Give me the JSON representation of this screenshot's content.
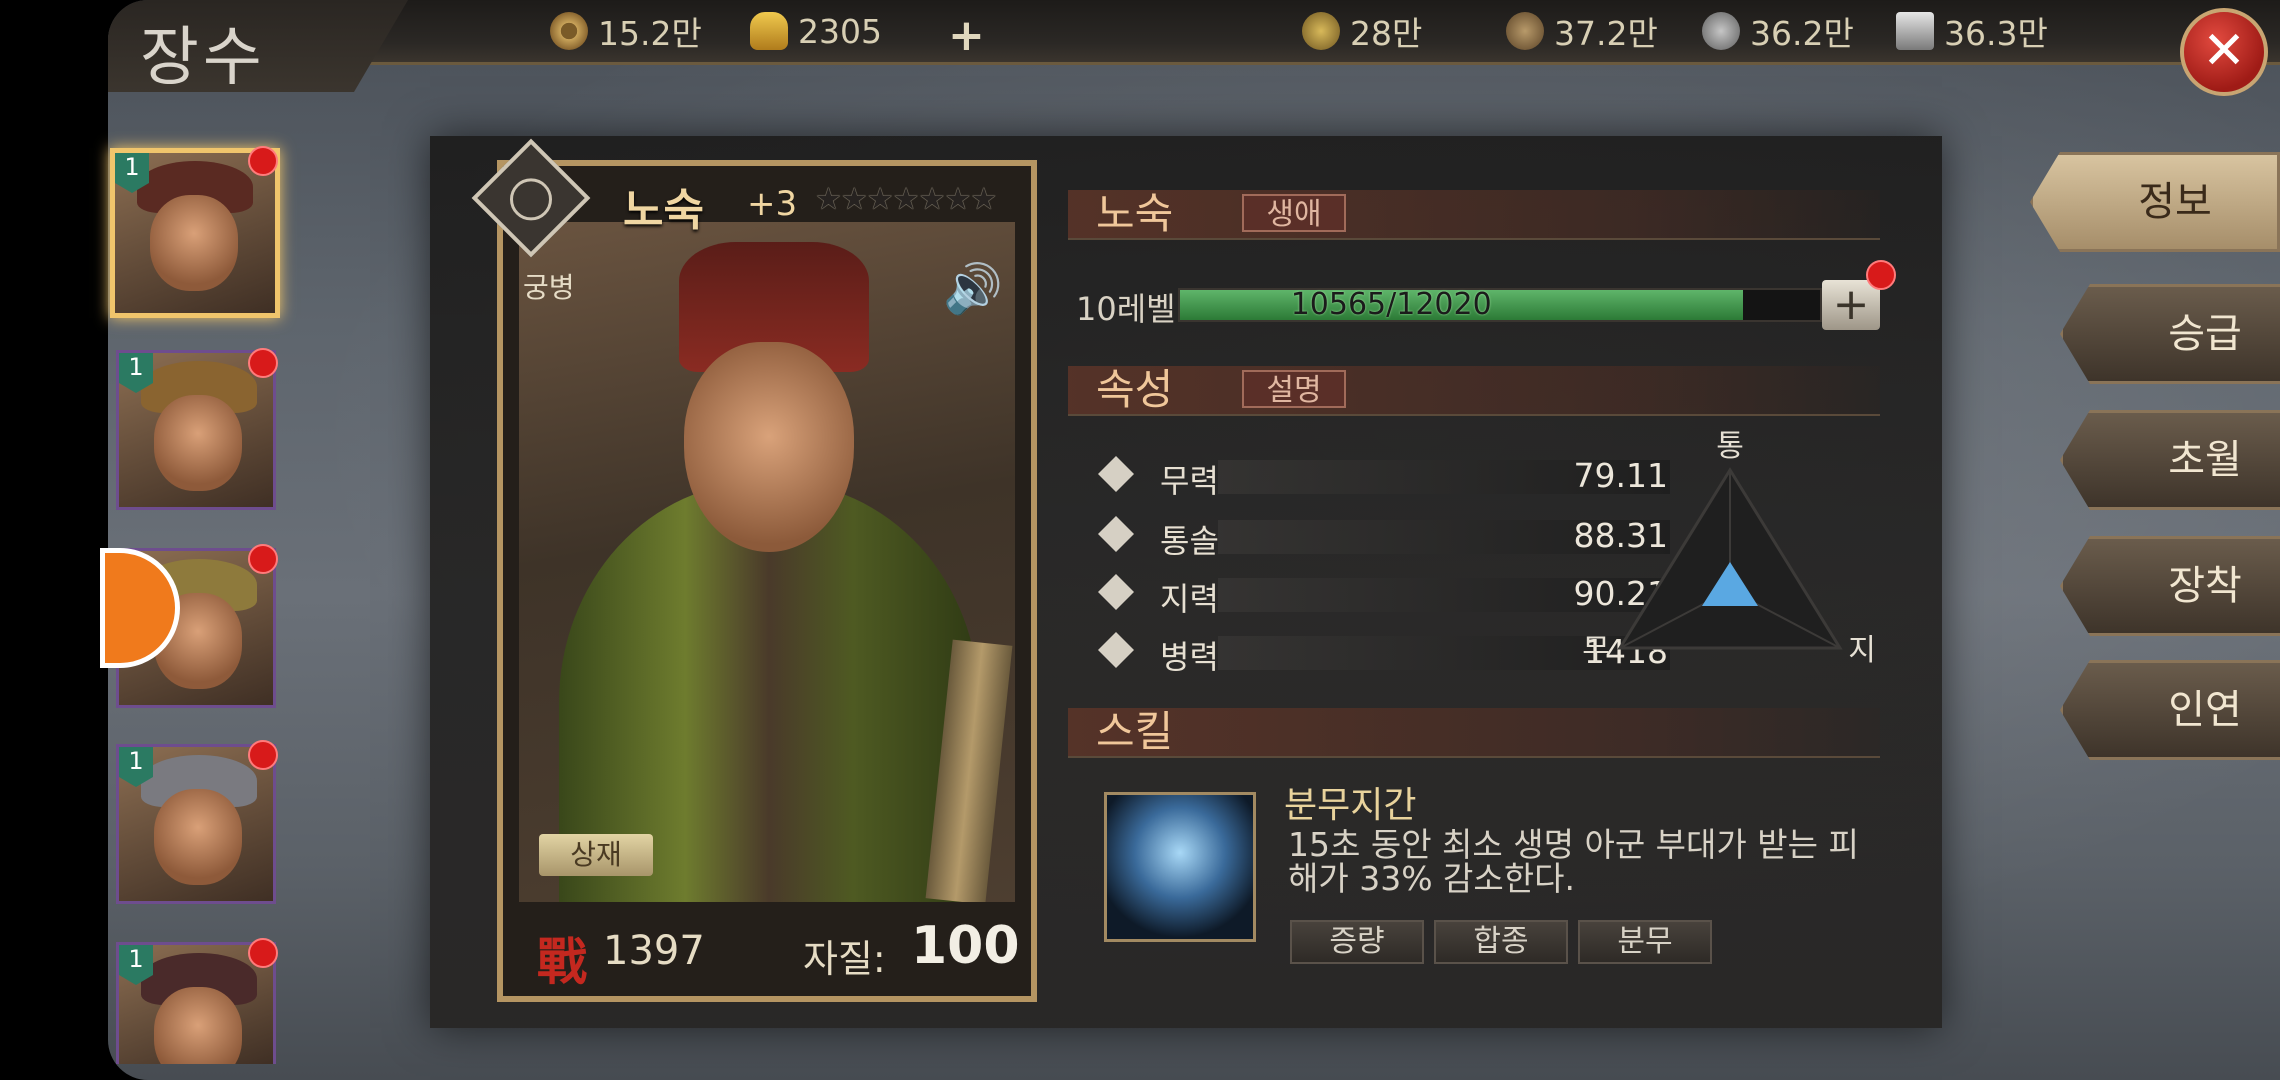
{
  "header": {
    "title": "장수",
    "currency": [
      {
        "icon": "copper-coin-icon",
        "value": "15.2만"
      },
      {
        "icon": "gold-ingot-icon",
        "value": "2305"
      }
    ],
    "add_label": "+",
    "resources": [
      {
        "icon": "grain-icon",
        "value": "28만"
      },
      {
        "icon": "wood-icon",
        "value": "37.2만"
      },
      {
        "icon": "stone-icon",
        "value": "36.2만"
      },
      {
        "icon": "iron-icon",
        "value": "36.3만"
      }
    ],
    "close_label": "✕"
  },
  "hero_list": [
    {
      "level": "1",
      "selected": true,
      "helm_color": "#5a2a22"
    },
    {
      "level": "1",
      "selected": false,
      "helm_color": "#8a6430"
    },
    {
      "level": "",
      "selected": false,
      "helm_color": "#8e7a3c"
    },
    {
      "level": "1",
      "selected": false,
      "helm_color": "#7a7a80"
    },
    {
      "level": "1",
      "selected": false,
      "helm_color": "#4a2a2a"
    }
  ],
  "card": {
    "name": "노숙",
    "plus": "+3",
    "stars": "★★★★★★★",
    "class": "궁병",
    "detail_button": "상재",
    "power_glyph": "戰",
    "power": "1397",
    "aptitude_label": "자질:",
    "aptitude": "100"
  },
  "info": {
    "name": "노숙",
    "bio_tag": "생애",
    "level_label": "10레벨",
    "xp_text": "10565/12020",
    "xp_fraction": 0.879,
    "level_plus": "+",
    "attr_title": "속성",
    "attr_tag": "설명",
    "stats": [
      {
        "name": "무력",
        "value": "79.11"
      },
      {
        "name": "통솔",
        "value": "88.31"
      },
      {
        "name": "지력",
        "value": "90.21"
      },
      {
        "name": "병력",
        "value": "1418"
      }
    ],
    "radar_labels": {
      "top": "통",
      "left": "무",
      "right": "지"
    },
    "skill_title": "스킬",
    "skill": {
      "name": "분무지간",
      "desc": "15초 동안 최소 생명 아군 부대가 받는 피해가 33% 감소한다.",
      "tags": [
        "증량",
        "합종",
        "분무"
      ]
    }
  },
  "tabs": [
    {
      "label": "정보",
      "active": true
    },
    {
      "label": "승급",
      "active": false
    },
    {
      "label": "초월",
      "active": false
    },
    {
      "label": "장착",
      "active": false
    },
    {
      "label": "인연",
      "active": false
    }
  ],
  "colors": {
    "accent_gold": "#f0c56c",
    "xp_green": "#3a9a46",
    "alert_red": "#d81a1a"
  }
}
